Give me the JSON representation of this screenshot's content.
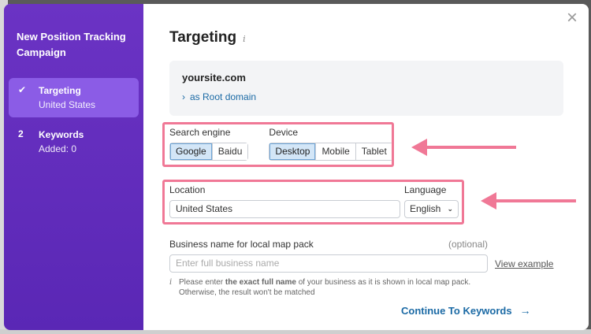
{
  "sidebar": {
    "title": "New Position Tracking Campaign",
    "steps": [
      {
        "mark": "✔",
        "name": "Targeting",
        "sub": "United States"
      },
      {
        "mark": "2",
        "name": "Keywords",
        "sub": "Added: 0"
      }
    ]
  },
  "main": {
    "close_icon": "×",
    "title": "Targeting",
    "title_info_icon": "i",
    "domain": {
      "name": "yoursite.com",
      "chevron": "›",
      "type": "as Root domain"
    },
    "search_engine": {
      "label": "Search engine",
      "options": [
        "Google",
        "Baidu"
      ],
      "selected": "Google"
    },
    "device": {
      "label": "Device",
      "options": [
        "Desktop",
        "Mobile",
        "Tablet"
      ],
      "selected": "Desktop"
    },
    "location": {
      "label": "Location",
      "value": "United States"
    },
    "language": {
      "label": "Language",
      "value": "English",
      "chevron": "⌄"
    },
    "business": {
      "label": "Business name for local map pack",
      "optional": "(optional)",
      "placeholder": "Enter full business name",
      "view_example": "View example",
      "hint_icon": "i",
      "hint_pre": "Please enter ",
      "hint_bold": "the exact full name",
      "hint_post": " of your business as it is shown in local map pack. Otherwise, the result won't be matched"
    },
    "continue_label": "Continue To Keywords",
    "continue_arrow": "→"
  },
  "colors": {
    "sidebar": "#6b33c4",
    "highlight": "#f07896",
    "link": "#1b6aa5"
  }
}
